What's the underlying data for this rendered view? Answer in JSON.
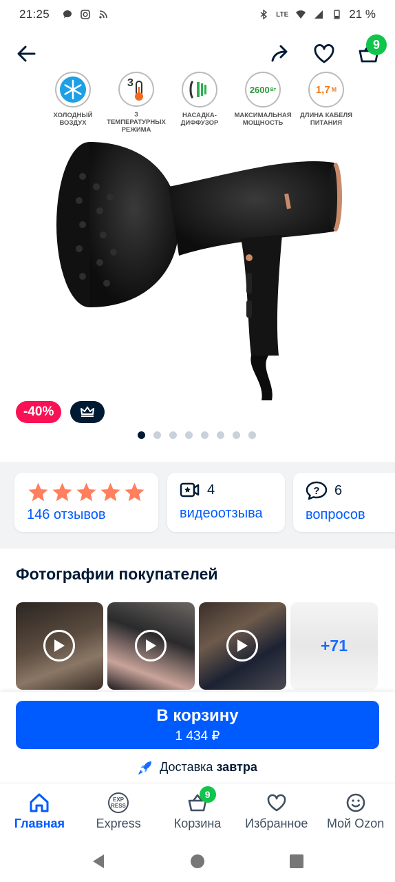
{
  "status_bar": {
    "time": "21:25",
    "battery": "21 %",
    "network": "LTE"
  },
  "app_bar": {
    "cart_count": "9"
  },
  "features": [
    {
      "icon": "snowflake-icon",
      "label": "ХОЛОДНЫЙ ВОЗДУХ",
      "value": ""
    },
    {
      "icon": "thermometer-icon",
      "label": "3 ТЕМПЕРАТУРНЫХ РЕЖИМА",
      "value": "3"
    },
    {
      "icon": "diffuser-icon",
      "label": "НАСАДКА-ДИФФУЗОР",
      "value": ""
    },
    {
      "icon": "power-icon",
      "label": "МАКСИМАЛЬНАЯ МОЩНОСТЬ",
      "value": "2600",
      "unit": "Вт"
    },
    {
      "icon": "cable-icon",
      "label": "ДЛИНА КАБЕЛЯ ПИТАНИЯ",
      "value": "1,7",
      "unit": "М"
    }
  ],
  "tags": {
    "discount": "-40%"
  },
  "gallery": {
    "total": 8,
    "active": 0
  },
  "stats": {
    "reviews": {
      "rating": 5,
      "link": "146 отзывов"
    },
    "video": {
      "count": "4",
      "link": "видеоотзыва"
    },
    "questions": {
      "count": "6",
      "link": "вопросов"
    }
  },
  "customer_photos": {
    "title": "Фотографии покупателей",
    "more": "+71"
  },
  "cta": {
    "label": "В корзину",
    "price": "1 434 ₽"
  },
  "delivery": {
    "text": "Доставка",
    "when": "завтра"
  },
  "bottom_nav": {
    "items": [
      {
        "label": "Главная",
        "icon": "home-icon"
      },
      {
        "label": "Express",
        "icon": "express-icon"
      },
      {
        "label": "Корзина",
        "icon": "basket-icon",
        "badge": "9"
      },
      {
        "label": "Избранное",
        "icon": "heart-icon"
      },
      {
        "label": "Мой Ozon",
        "icon": "smile-icon"
      }
    ]
  },
  "colors": {
    "accent": "#005bff",
    "discount": "#f91155",
    "badge": "#10c44c",
    "star": "#ff7f5e",
    "text": "#001a34"
  }
}
